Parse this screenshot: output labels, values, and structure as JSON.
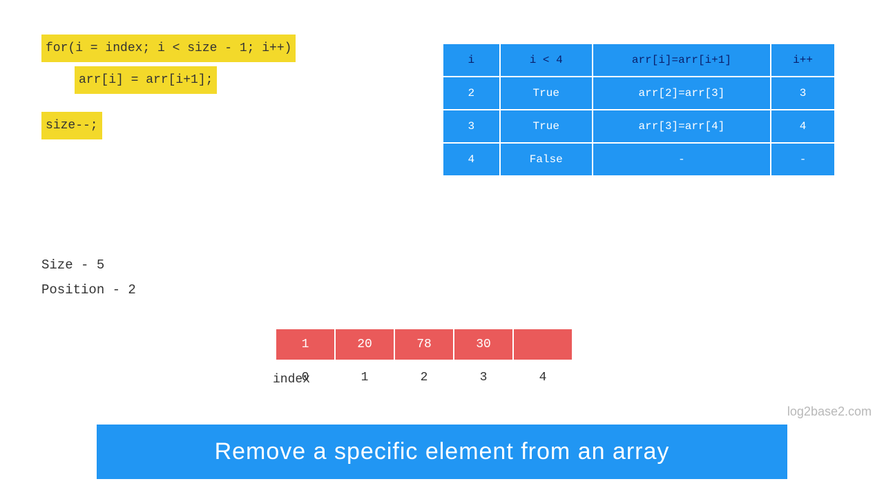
{
  "code": {
    "line1": "for(i = index; i < size - 1; i++)",
    "line2": "arr[i] = arr[i+1];",
    "line3": "size--;"
  },
  "trace": {
    "headers": {
      "i": "i",
      "cond": "i < 4",
      "assign": "arr[i]=arr[i+1]",
      "inc": "i++"
    },
    "rows": [
      {
        "i": "2",
        "cond": "True",
        "assign": "arr[2]=arr[3]",
        "inc": "3"
      },
      {
        "i": "3",
        "cond": "True",
        "assign": "arr[3]=arr[4]",
        "inc": "4"
      },
      {
        "i": "4",
        "cond": "False",
        "assign": "-",
        "inc": "-"
      }
    ]
  },
  "info": {
    "size": "Size - 5",
    "position": "Position - 2"
  },
  "array": {
    "label": "index",
    "values": [
      "1",
      "20",
      "78",
      "30",
      ""
    ],
    "indices": [
      "0",
      "1",
      "2",
      "3",
      "4"
    ]
  },
  "watermark": "log2base2.com",
  "title": "Remove a specific element from an array"
}
